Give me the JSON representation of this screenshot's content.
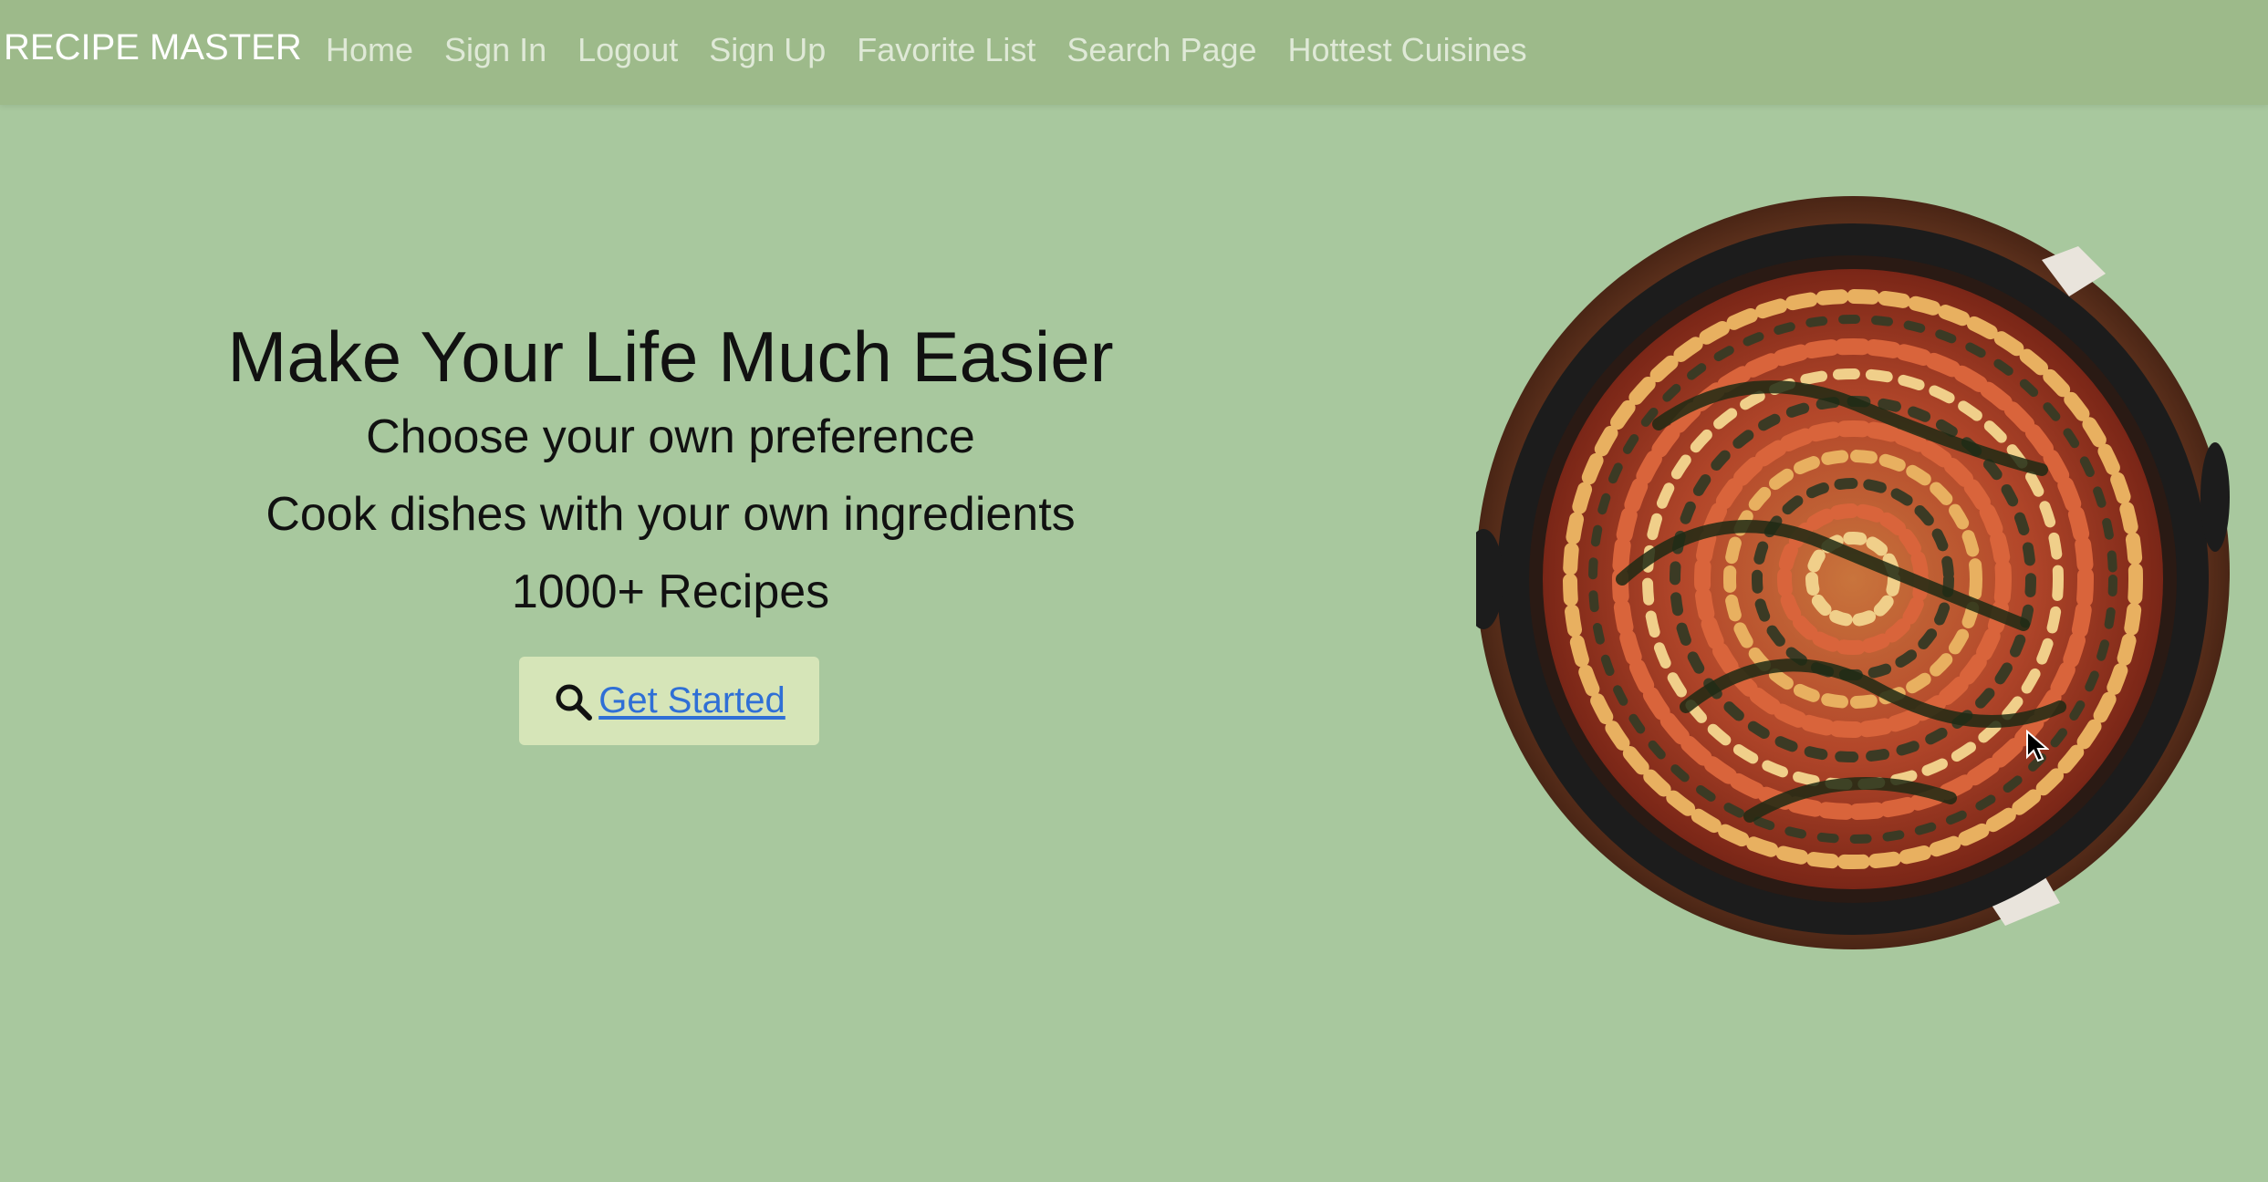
{
  "navbar": {
    "brand": "RECIPE MASTER",
    "items": [
      {
        "label": "Home"
      },
      {
        "label": "Sign In"
      },
      {
        "label": "Logout"
      },
      {
        "label": "Sign Up"
      },
      {
        "label": "Favorite List"
      },
      {
        "label": "Search Page"
      },
      {
        "label": "Hottest Cuisines"
      }
    ]
  },
  "hero": {
    "title": "Make Your Life Much Easier",
    "lines": [
      "Choose your own preference",
      "Cook dishes with your own ingredients",
      "1000+ Recipes"
    ],
    "cta_label": "Get Started",
    "cta_icon": "search-icon",
    "image": "ratatouille-skillet"
  },
  "colors": {
    "page_bg": "#a8c89e",
    "navbar_bg": "#9dba8a",
    "cta_bg": "#d6e5b8",
    "link": "#2f6fd6"
  }
}
